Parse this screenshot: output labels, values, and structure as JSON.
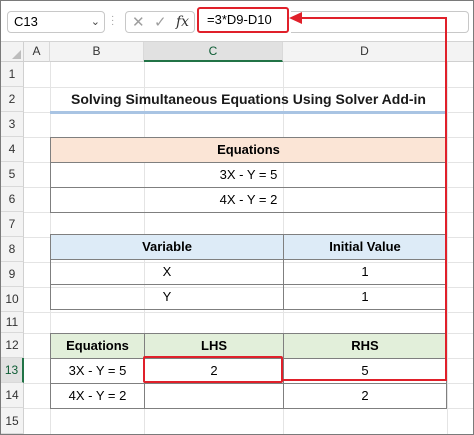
{
  "formula_bar": {
    "name_box": "C13",
    "cancel_icon": "✕",
    "enter_icon": "✓",
    "fx_label": "fx",
    "formula": "=3*D9-D10"
  },
  "columns": [
    "A",
    "B",
    "C",
    "D"
  ],
  "rows": [
    "1",
    "2",
    "3",
    "4",
    "5",
    "6",
    "7",
    "8",
    "9",
    "10",
    "11",
    "12",
    "13",
    "14",
    "15"
  ],
  "title": "Solving Simultaneous Equations Using Solver Add-in",
  "equations_table": {
    "header": "Equations",
    "rows": [
      "3X - Y = 5",
      "4X - Y = 2"
    ]
  },
  "variables_table": {
    "headers": [
      "Variable",
      "Initial Value"
    ],
    "rows": [
      [
        "X",
        "1"
      ],
      [
        "Y",
        "1"
      ]
    ]
  },
  "solver_table": {
    "headers": [
      "Equations",
      "LHS",
      "RHS"
    ],
    "rows": [
      [
        "3X - Y = 5",
        "2",
        "5"
      ],
      [
        "4X - Y = 2",
        "",
        "2"
      ]
    ]
  },
  "colors": {
    "highlight_red": "#e0202a",
    "peach_header": "#fbe5d6",
    "blue_header": "#ddebf7",
    "green_header": "#e2efda",
    "excel_green": "#217346"
  }
}
